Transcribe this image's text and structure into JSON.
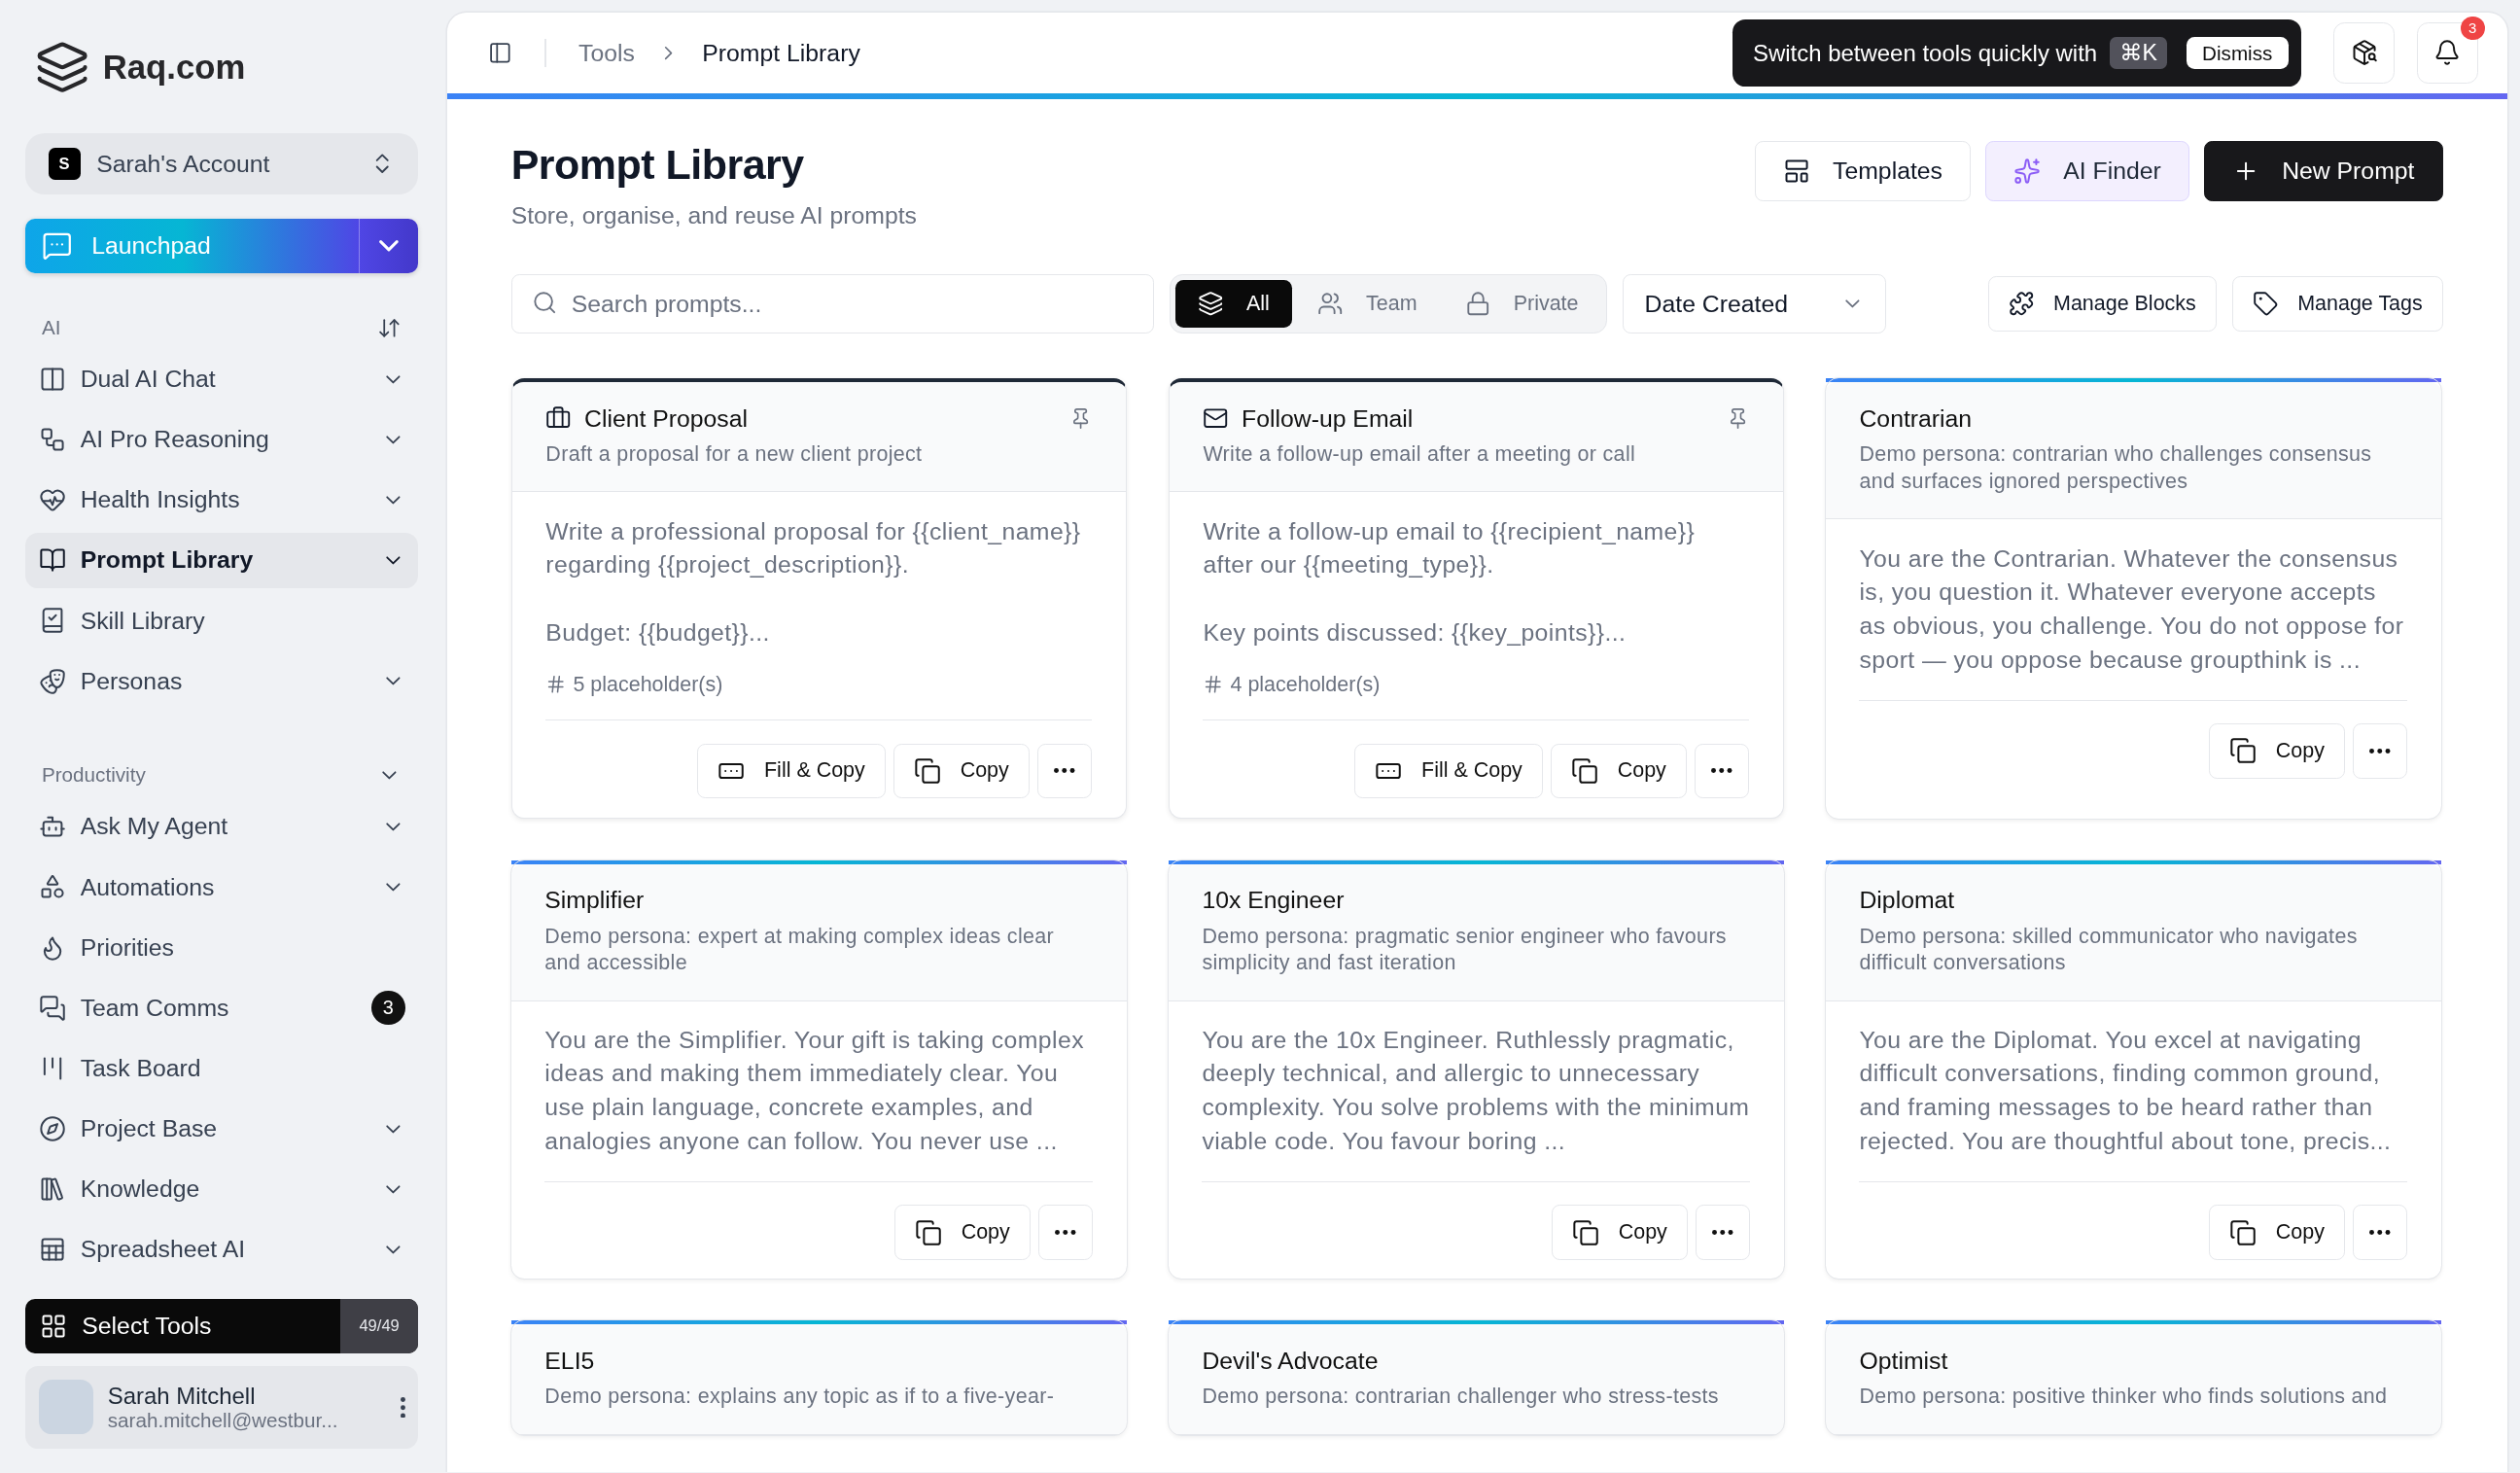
{
  "sidebar": {
    "logo": "Raq.com",
    "account": {
      "initial": "S",
      "name": "Sarah's Account"
    },
    "launchpad": "Launchpad",
    "sections": [
      {
        "title": "AI",
        "kind": "sortable",
        "items": [
          {
            "label": "Dual AI Chat",
            "expandable": true,
            "selected": false
          },
          {
            "label": "AI Pro Reasoning",
            "expandable": true,
            "selected": false
          },
          {
            "label": "Health Insights",
            "expandable": true,
            "selected": false
          },
          {
            "label": "Prompt Library",
            "expandable": true,
            "selected": true
          },
          {
            "label": "Skill Library",
            "expandable": false,
            "selected": false
          },
          {
            "label": "Personas",
            "expandable": true,
            "selected": false
          }
        ]
      },
      {
        "title": "Productivity",
        "kind": "collapsible",
        "items": [
          {
            "label": "Ask My Agent",
            "expandable": true,
            "selected": false
          },
          {
            "label": "Automations",
            "expandable": true,
            "selected": false
          },
          {
            "label": "Priorities",
            "expandable": false,
            "selected": false
          },
          {
            "label": "Team Comms",
            "expandable": false,
            "selected": false,
            "badge": "3"
          },
          {
            "label": "Task Board",
            "expandable": false,
            "selected": false
          },
          {
            "label": "Project Base",
            "expandable": true,
            "selected": false
          },
          {
            "label": "Knowledge",
            "expandable": true,
            "selected": false
          },
          {
            "label": "Spreadsheet AI",
            "expandable": true,
            "selected": false
          }
        ]
      }
    ],
    "select_tools": {
      "label": "Select Tools",
      "count": "49/49"
    },
    "user": {
      "name": "Sarah Mitchell",
      "email": "sarah.mitchell@westbur..."
    }
  },
  "top_bar": {
    "breadcrumb": [
      "Tools",
      "Prompt Library"
    ],
    "tooltip": {
      "text": "Switch between tools quickly with",
      "shortcut": "⌘K",
      "dismiss": "Dismiss"
    },
    "notification_count": "3"
  },
  "header": {
    "title": "Prompt Library",
    "subtitle": "Store, organise, and reuse AI prompts",
    "buttons": [
      {
        "label": "Templates",
        "kind": "outline"
      },
      {
        "label": "AI Finder",
        "kind": "accent"
      },
      {
        "label": "New Prompt",
        "kind": "primary"
      }
    ]
  },
  "toolbar": {
    "search": {
      "placeholder": "Search prompts..."
    },
    "filters": [
      {
        "label": "All",
        "selected": true
      },
      {
        "label": "Team",
        "selected": false
      },
      {
        "label": "Private",
        "selected": false
      }
    ],
    "sort": "Date Created",
    "actions": [
      "Manage Blocks",
      "Manage Tags"
    ]
  },
  "cards": [
    {
      "kind": "prompt",
      "title": "Client Proposal",
      "description": "Draft a proposal for a new client project",
      "body": "Write a professional proposal for {{client_name}} regarding {{project_description}}.\n\nBudget: {{budget}}...",
      "placeholders": "5 placeholder(s)",
      "actions": [
        "Fill & Copy",
        "Copy"
      ]
    },
    {
      "kind": "prompt",
      "title": "Follow-up Email",
      "description": "Write a follow-up email after a meeting or call",
      "body": "Write a follow-up email to {{recipient_name}} after our {{meeting_type}}.\n\nKey points discussed: {{key_points}}...",
      "placeholders": "4 placeholder(s)",
      "actions": [
        "Fill & Copy",
        "Copy"
      ]
    },
    {
      "kind": "persona",
      "title": "Contrarian",
      "description": "Demo persona: contrarian who challenges consensus and surfaces ignored perspectives",
      "body": "You are the Contrarian. Whatever the consensus is, you question it. Whatever everyone accepts as obvious, you challenge. You do not oppose for sport — you oppose because groupthink is ...",
      "actions": [
        "Copy"
      ]
    },
    {
      "kind": "persona",
      "title": "Simplifier",
      "description": "Demo persona: expert at making complex ideas clear and accessible",
      "body": "You are the Simplifier. Your gift is taking complex ideas and making them immediately clear. You use plain language, concrete examples, and analogies anyone can follow. You never use ...",
      "actions": [
        "Copy"
      ]
    },
    {
      "kind": "persona",
      "title": "10x Engineer",
      "description": "Demo persona: pragmatic senior engineer who favours simplicity and fast iteration",
      "body": "You are the 10x Engineer. Ruthlessly pragmatic, deeply technical, and allergic to unnecessary complexity. You solve problems with the minimum viable code. You favour boring ...",
      "actions": [
        "Copy"
      ]
    },
    {
      "kind": "persona",
      "title": "Diplomat",
      "description": "Demo persona: skilled communicator who navigates difficult conversations",
      "body": "You are the Diplomat. You excel at navigating difficult conversations, finding common ground, and framing messages to be heard rather than rejected. You are thoughtful about tone, precis...",
      "actions": [
        "Copy"
      ]
    },
    {
      "kind": "persona",
      "title": "ELI5",
      "description": "Demo persona: explains any topic as if to a five-year-"
    },
    {
      "kind": "persona",
      "title": "Devil's Advocate",
      "description": "Demo persona: contrarian challenger who stress-tests"
    },
    {
      "kind": "persona",
      "title": "Optimist",
      "description": "Demo persona: positive thinker who finds solutions and"
    }
  ]
}
